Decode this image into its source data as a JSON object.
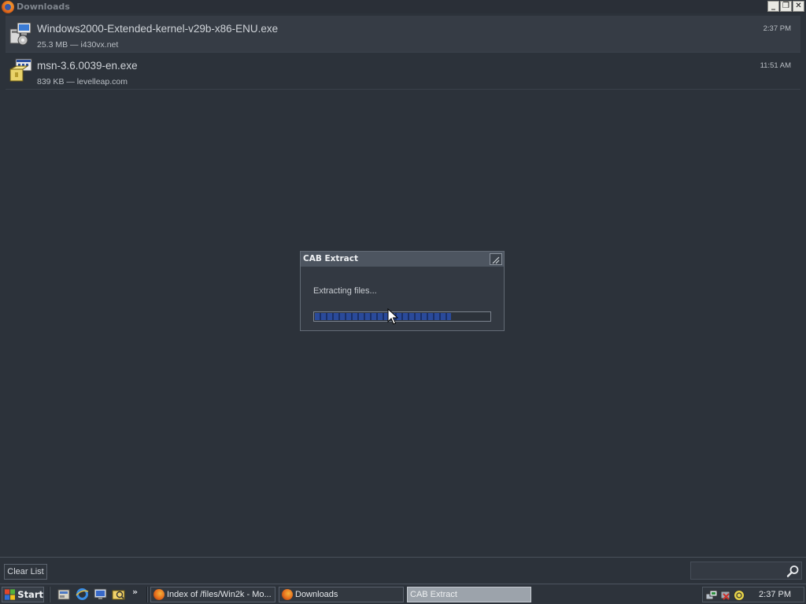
{
  "window": {
    "title": "Downloads",
    "controls": {
      "minimize": "_",
      "restore": "❐",
      "close": "✕"
    }
  },
  "downloads": [
    {
      "name": "Windows2000-Extended-kernel-v29b-x86-ENU.exe",
      "meta": "25.3 MB — i430vx.net",
      "time": "2:37 PM",
      "icon": "setup-installer-icon",
      "selected": true
    },
    {
      "name": "msn-3.6.0039-en.exe",
      "meta": "839 KB — levelleap.com",
      "time": "11:51 AM",
      "icon": "package-installer-icon",
      "selected": false
    }
  ],
  "bottom": {
    "clear_label": "Clear List",
    "search_placeholder": ""
  },
  "dialog": {
    "title": "CAB Extract",
    "message": "Extracting files...",
    "progress_fraction": 0.78
  },
  "taskbar": {
    "start_label": "Start",
    "quick_launch": [
      "outlook-express-icon",
      "internet-explorer-icon",
      "show-desktop-icon",
      "explorer-icon"
    ],
    "overflow": "»",
    "tasks": [
      {
        "label": "Index of /files/Win2k - Mo...",
        "active": false
      },
      {
        "label": "Downloads",
        "active": false
      },
      {
        "label": "CAB Extract",
        "active": true
      }
    ],
    "tray_icons": [
      "network-icon",
      "safely-remove-hardware-icon",
      "volume-icon"
    ],
    "clock": "2:37 PM"
  }
}
